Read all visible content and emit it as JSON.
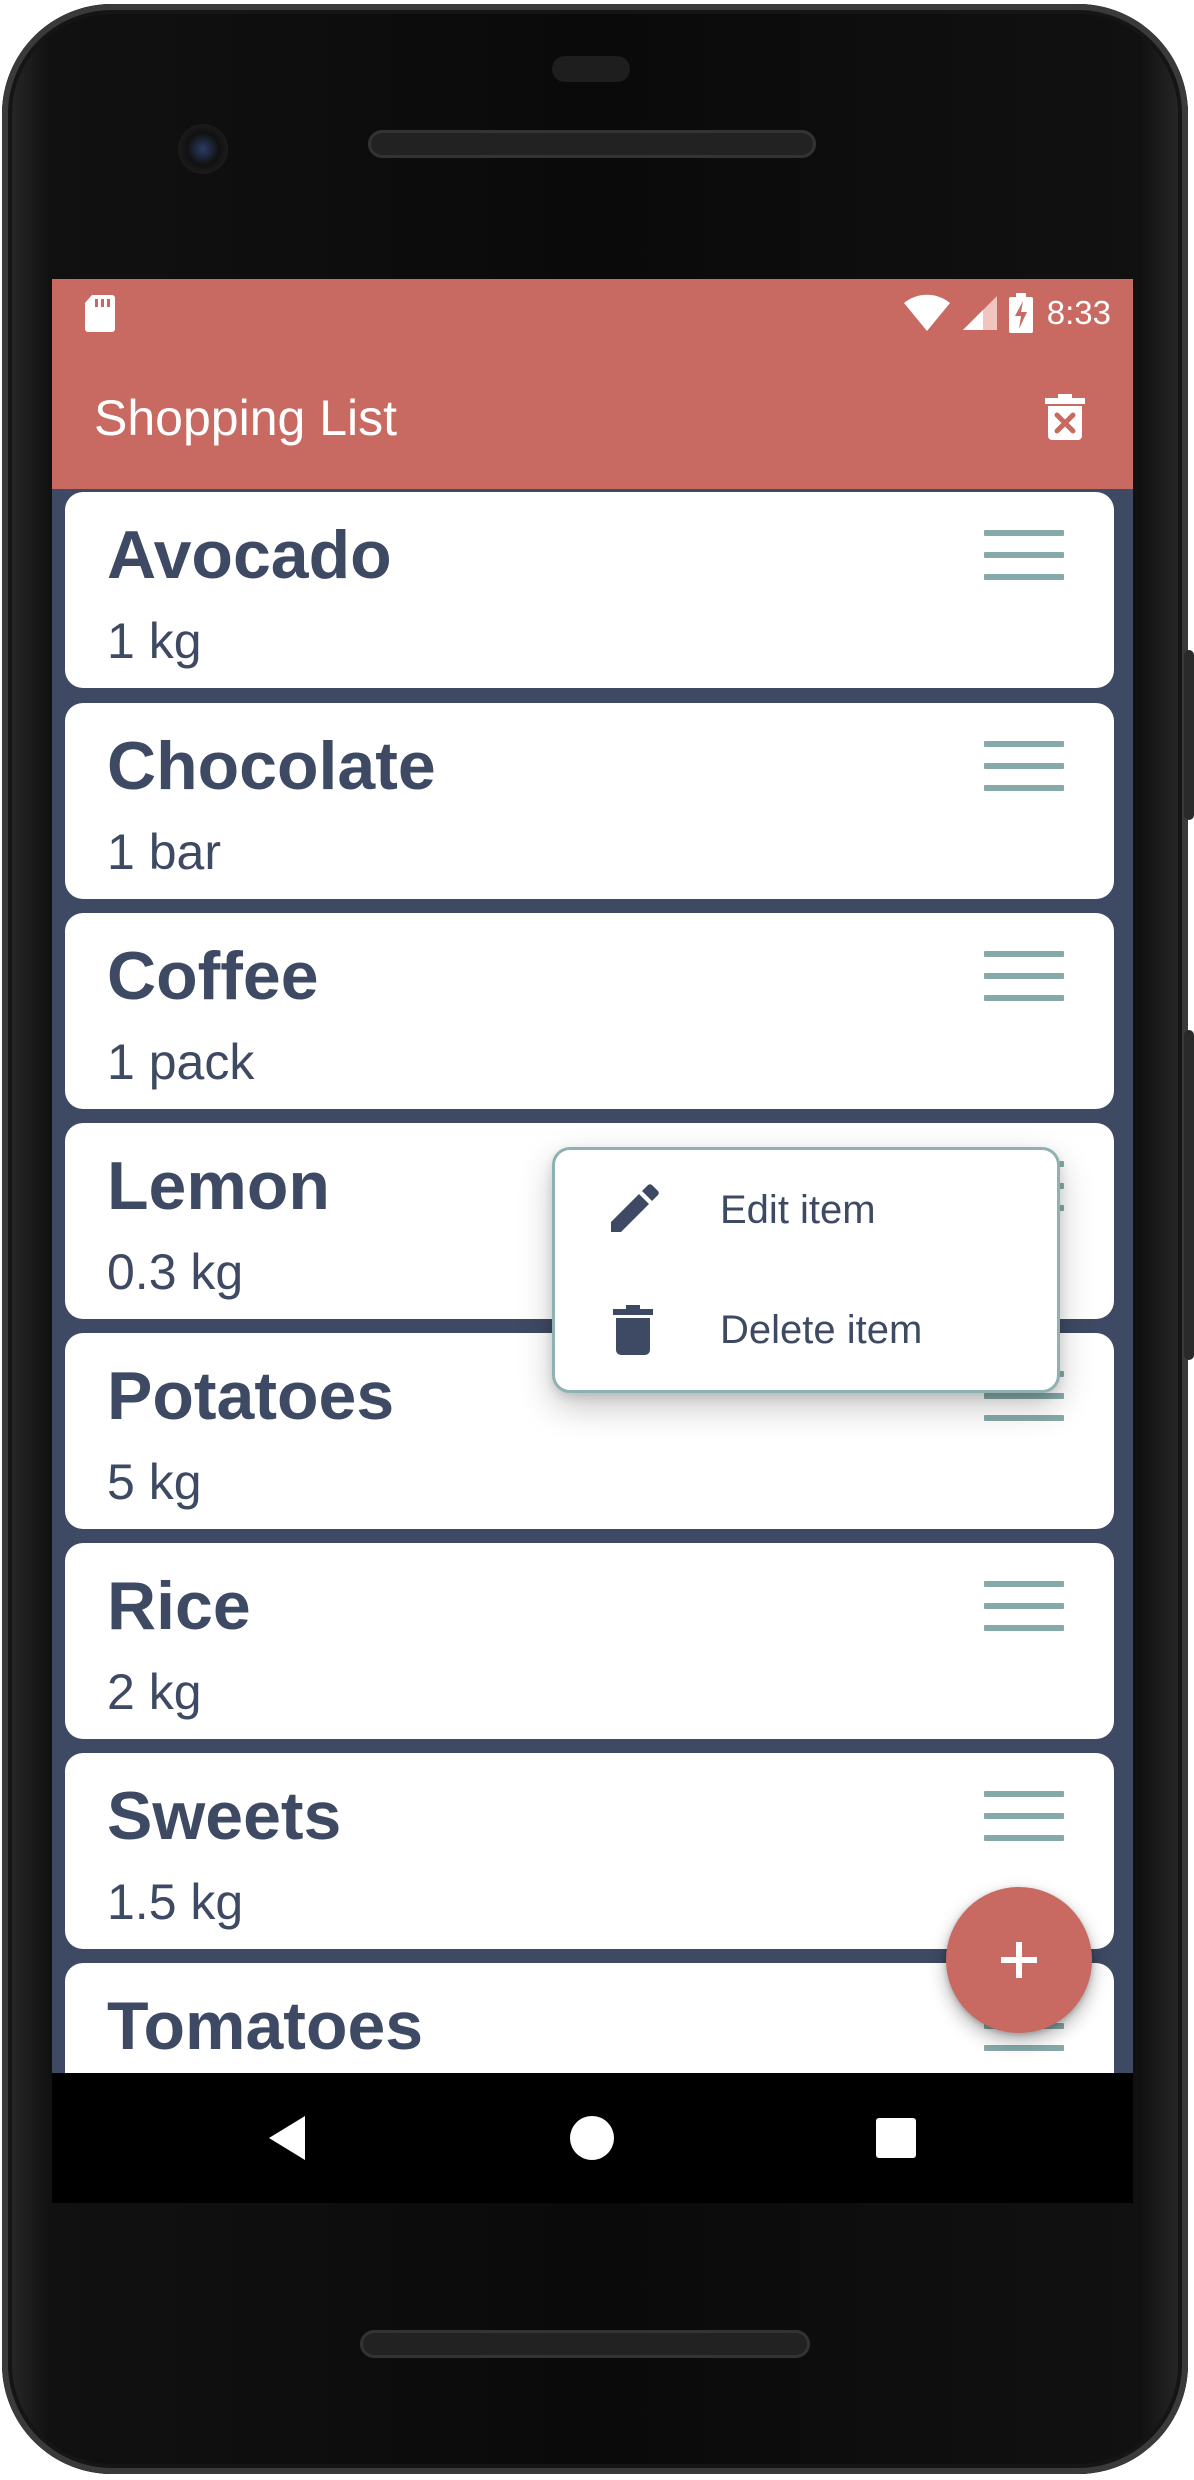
{
  "status_bar": {
    "time": "8:33"
  },
  "app_bar": {
    "title": "Shopping List",
    "clear_icon": "delete-forever-icon"
  },
  "items": [
    {
      "name": "Avocado",
      "quantity": "1 kg"
    },
    {
      "name": "Chocolate",
      "quantity": "1 bar"
    },
    {
      "name": "Coffee",
      "quantity": "1 pack"
    },
    {
      "name": "Lemon",
      "quantity": "0.3 kg"
    },
    {
      "name": "Potatoes",
      "quantity": "5 kg"
    },
    {
      "name": "Rice",
      "quantity": "2 kg"
    },
    {
      "name": "Sweets",
      "quantity": "1.5 kg"
    },
    {
      "name": "Tomatoes",
      "quantity": ""
    }
  ],
  "context_menu": {
    "edit_label": "Edit item",
    "delete_label": "Delete item",
    "edit_icon": "pencil-icon",
    "delete_icon": "trash-icon"
  },
  "fab": {
    "icon": "plus-icon"
  },
  "colors": {
    "primary": "#c86a62",
    "background": "#3e4a63",
    "text": "#3e4a63",
    "handle": "#86aaa9",
    "menu_border": "#8fb1b1"
  }
}
